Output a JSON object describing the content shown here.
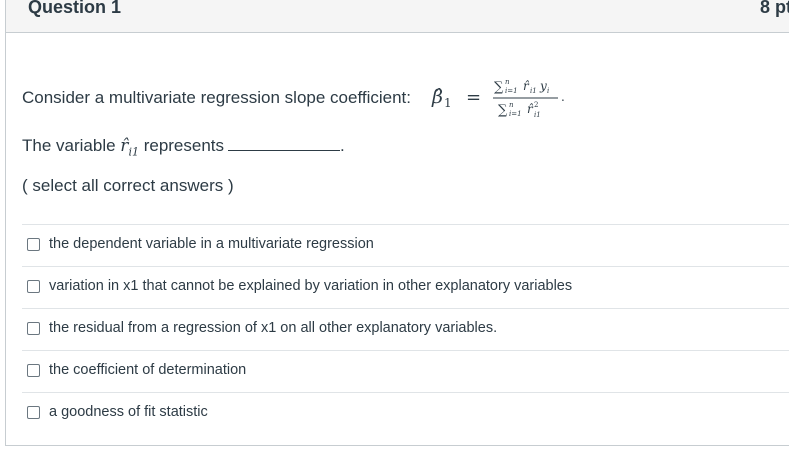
{
  "question": {
    "title": "Question 1",
    "points": "8 pt",
    "prompt": "Consider a multivariate regression slope coefficient:",
    "formula": {
      "lhs": "β̂",
      "lhs_sub": "1",
      "equals": "=",
      "num_sum": "∑",
      "num_sup": "n",
      "num_sub": "i=1",
      "num_term": "r̂",
      "num_term_sub": "i1",
      "num_y": "y",
      "num_y_sub": "i",
      "den_sum": "∑",
      "den_sup": "n",
      "den_sub": "i=1",
      "den_term": "r̂",
      "den_term_sup": "2",
      "den_term_sub": "i1",
      "period": "."
    },
    "variable_prefix": "The variable",
    "variable_symbol": "r̂",
    "variable_sub": "i1",
    "variable_suffix": "represents",
    "blank_end": ".",
    "instruction": "( select all correct answers )"
  },
  "answers": [
    {
      "label": "the dependent variable in a multivariate regression",
      "checked": false
    },
    {
      "label": "variation in x1 that cannot be explained by variation in other explanatory variables",
      "checked": false
    },
    {
      "label": "the residual from a regression of x1 on all other explanatory variables.",
      "checked": false
    },
    {
      "label": "the coefficient of determination",
      "checked": false
    },
    {
      "label": "a goodness of fit statistic",
      "checked": false
    }
  ]
}
